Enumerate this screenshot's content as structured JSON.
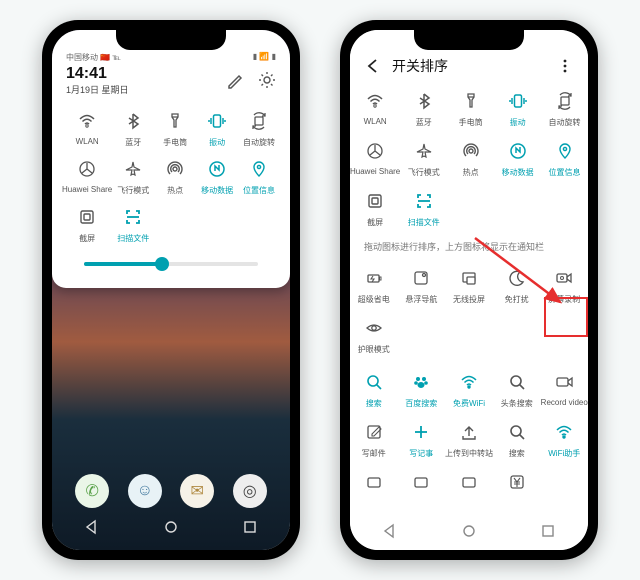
{
  "phone1": {
    "status": {
      "carrier": "中国移动 🇨🇳 ℡",
      "right": "▮ 📶 ▮"
    },
    "time": "14:41",
    "date": "1月19日 星期日",
    "tiles": [
      {
        "id": "wlan",
        "label": "WLAN",
        "active": false
      },
      {
        "id": "bluetooth",
        "label": "蓝牙",
        "active": false
      },
      {
        "id": "flashlight",
        "label": "手电筒",
        "active": false
      },
      {
        "id": "vibrate",
        "label": "振动",
        "active": true
      },
      {
        "id": "autorotate",
        "label": "自动旋转",
        "active": false
      },
      {
        "id": "huaweishare",
        "label": "Huawei Share",
        "active": false
      },
      {
        "id": "airplane",
        "label": "飞行模式",
        "active": false
      },
      {
        "id": "hotspot",
        "label": "热点",
        "active": false
      },
      {
        "id": "mobiledata",
        "label": "移动数据",
        "active": true
      },
      {
        "id": "location",
        "label": "位置信息",
        "active": true
      },
      {
        "id": "screenshot",
        "label": "截屏",
        "active": false
      },
      {
        "id": "scanfile",
        "label": "扫描文件",
        "active": true
      }
    ]
  },
  "phone2": {
    "title": "开关排序",
    "group_hint": "拖动图标进行排序，上方图标将显示在通知栏",
    "groupA": [
      {
        "id": "wlan",
        "label": "WLAN",
        "active": false
      },
      {
        "id": "bluetooth",
        "label": "蓝牙",
        "active": false
      },
      {
        "id": "flashlight",
        "label": "手电筒",
        "active": false
      },
      {
        "id": "vibrate",
        "label": "振动",
        "active": true
      },
      {
        "id": "autorotate",
        "label": "自动旋转",
        "active": false
      },
      {
        "id": "huaweishare",
        "label": "Huawei Share",
        "active": false
      },
      {
        "id": "airplane",
        "label": "飞行模式",
        "active": false
      },
      {
        "id": "hotspot",
        "label": "热点",
        "active": false
      },
      {
        "id": "mobiledata",
        "label": "移动数据",
        "active": true
      },
      {
        "id": "location",
        "label": "位置信息",
        "active": true
      },
      {
        "id": "screenshot",
        "label": "截屏",
        "active": false
      },
      {
        "id": "scanfile",
        "label": "扫描文件",
        "active": true
      }
    ],
    "groupB": [
      {
        "id": "ultrasave",
        "label": "超级省电"
      },
      {
        "id": "floatnav",
        "label": "悬浮导航"
      },
      {
        "id": "cast",
        "label": "无线投屏"
      },
      {
        "id": "dnd",
        "label": "免打扰"
      },
      {
        "id": "screenrec",
        "label": "屏幕录制"
      },
      {
        "id": "eyecare",
        "label": "护眼模式"
      }
    ],
    "groupC": [
      {
        "id": "search",
        "label": "搜索",
        "active": true
      },
      {
        "id": "baidu",
        "label": "百度搜索",
        "active": true
      },
      {
        "id": "freewifi",
        "label": "免费WiFi",
        "active": true
      },
      {
        "id": "headlines",
        "label": "头条搜索",
        "active": false
      },
      {
        "id": "recordvideo",
        "label": "Record video",
        "active": false
      },
      {
        "id": "compose",
        "label": "写邮件",
        "active": false
      },
      {
        "id": "note",
        "label": "写记事",
        "active": true
      },
      {
        "id": "upload",
        "label": "上传到中转站",
        "active": false
      },
      {
        "id": "search2",
        "label": "搜索",
        "active": false
      },
      {
        "id": "wifiassist",
        "label": "WiFi助手",
        "active": true
      },
      {
        "id": "misc1",
        "label": "",
        "active": false
      },
      {
        "id": "misc2",
        "label": "",
        "active": false
      },
      {
        "id": "misc3",
        "label": "",
        "active": false
      },
      {
        "id": "yuan",
        "label": "",
        "active": false
      }
    ]
  },
  "icons": {
    "wlan": "wifi-icon",
    "bluetooth": "bluetooth-icon",
    "flashlight": "flashlight-icon",
    "vibrate": "vibrate-icon",
    "autorotate": "rotate-icon",
    "huaweishare": "share-icon",
    "airplane": "airplane-icon",
    "hotspot": "hotspot-icon",
    "mobiledata": "data-icon",
    "location": "location-icon",
    "screenshot": "screenshot-icon",
    "scanfile": "scan-icon",
    "ultrasave": "battery-icon",
    "floatnav": "floatnav-icon",
    "cast": "cast-icon",
    "dnd": "moon-icon",
    "screenrec": "record-icon",
    "eyecare": "eye-icon",
    "search": "search-icon",
    "baidu": "paw-icon",
    "freewifi": "wifi-icon",
    "headlines": "search-icon",
    "recordvideo": "video-icon",
    "compose": "compose-icon",
    "note": "plus-icon",
    "upload": "upload-icon",
    "search2": "search-icon",
    "wifiassist": "wifi-icon",
    "misc1": "box-icon",
    "misc2": "box-icon",
    "misc3": "box-icon",
    "yuan": "yen-icon"
  }
}
